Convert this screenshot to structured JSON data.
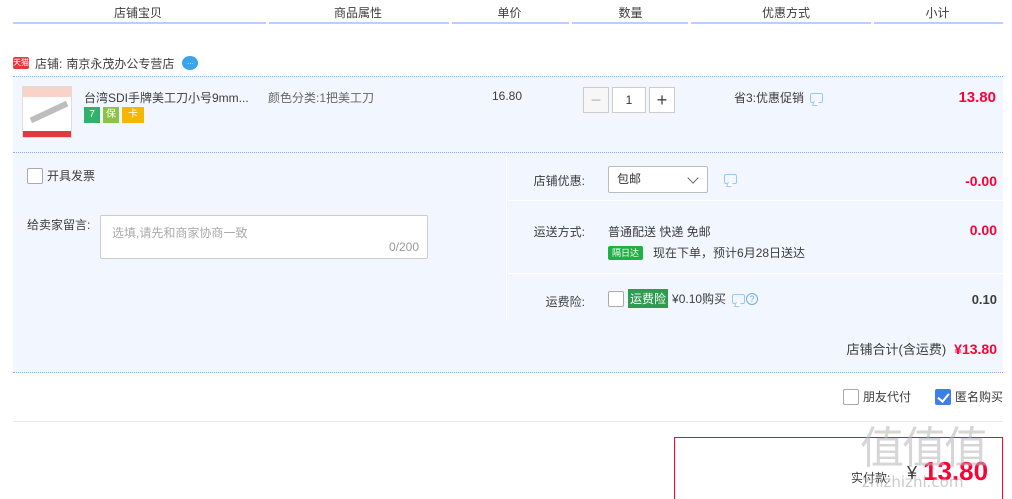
{
  "header": {
    "columns": [
      "店铺宝贝",
      "商品属性",
      "单价",
      "数量",
      "优惠方式",
      "小计"
    ]
  },
  "shop": {
    "logo_text": "天猫",
    "label": "店铺:",
    "name": "南京永茂办公专营店"
  },
  "item": {
    "title": "台湾SDI手牌美工刀小号9mm...",
    "attribute": "颜色分类:1把美工刀",
    "price": "16.80",
    "quantity": "1",
    "promotion": "省3:优惠促销",
    "subtotal": "13.80",
    "badges": [
      "7",
      "保",
      "卡"
    ]
  },
  "options": {
    "invoice_label": "开具发票",
    "message_label": "给卖家留言:",
    "message_placeholder": "选填,请先和商家协商一致",
    "message_count": "0/200",
    "shop_discount_label": "店铺优惠:",
    "shop_discount_value": "包邮",
    "shop_discount_amount": "-0.00",
    "shipping_label": "运送方式:",
    "shipping_text": "普通配送 快递 免邮",
    "shipping_badge": "隔日达",
    "shipping_eta": "现在下单，预计6月28日送达",
    "shipping_amount": "0.00",
    "insurance_label": "运费险:",
    "insurance_badge": "运费险",
    "insurance_text": "¥0.10购买",
    "insurance_amount": "0.10",
    "shop_total_label": "店铺合计(含运费)",
    "shop_total_value": "¥13.80"
  },
  "pay_options": {
    "friend_pay": "朋友代付",
    "anonymous": "匿名购买"
  },
  "payment": {
    "label": "实付款:",
    "currency": "¥",
    "value": "13.80"
  },
  "watermark": {
    "main": "值值值",
    "sub": "zhizhizhi.com"
  },
  "colors": {
    "accent_red": "#ff0036",
    "header_line": "#b2d1ff",
    "panel_bg": "#f2f7ff",
    "checkbox_blue": "#3d7fe7"
  }
}
